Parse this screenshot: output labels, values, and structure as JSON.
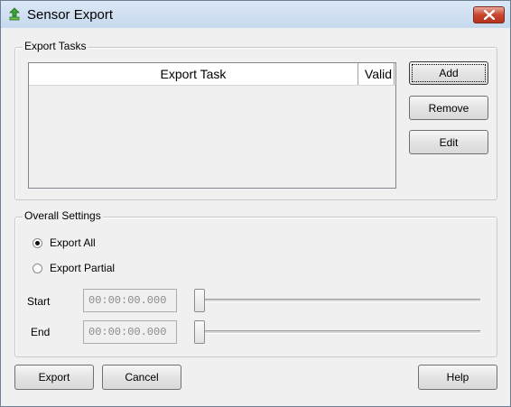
{
  "window": {
    "title": "Sensor Export",
    "icon": "sensor-app-icon"
  },
  "export_tasks": {
    "group_label": "Export Tasks",
    "columns": [
      "Export Task",
      "Valid"
    ],
    "rows": [],
    "buttons": {
      "add": "Add",
      "remove": "Remove",
      "edit": "Edit"
    }
  },
  "overall_settings": {
    "group_label": "Overall Settings",
    "export_mode": {
      "options": [
        "Export All",
        "Export Partial"
      ],
      "selected": "Export All"
    },
    "start": {
      "label": "Start",
      "value": "00:00:00.000",
      "slider_fraction": 0
    },
    "end": {
      "label": "End",
      "value": "00:00:00.000",
      "slider_fraction": 0
    }
  },
  "footer": {
    "export": "Export",
    "cancel": "Cancel",
    "help": "Help"
  },
  "colors": {
    "titlebar": "#c6d9ee",
    "close_button": "#c9452f",
    "dialog_bg": "#f0f0f0"
  }
}
